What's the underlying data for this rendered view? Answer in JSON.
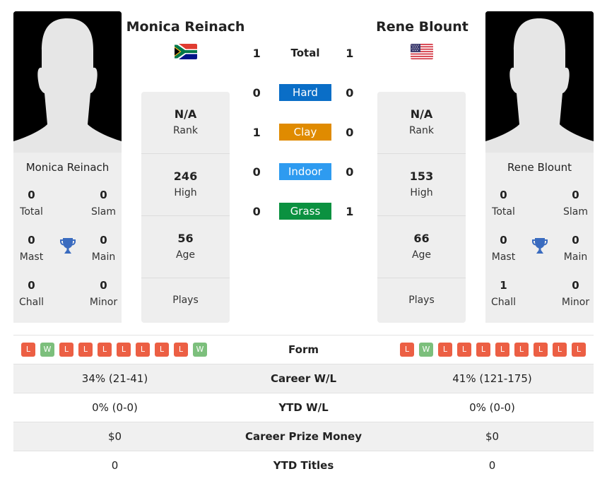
{
  "players": {
    "left": {
      "name": "Monica Reinach",
      "country": "South Africa",
      "flag_icon": "flag-south-africa-icon",
      "titles": {
        "total": {
          "value": "0",
          "label": "Total"
        },
        "slam": {
          "value": "0",
          "label": "Slam"
        },
        "mast": {
          "value": "0",
          "label": "Mast"
        },
        "main": {
          "value": "0",
          "label": "Main"
        },
        "chall": {
          "value": "0",
          "label": "Chall"
        },
        "minor": {
          "value": "0",
          "label": "Minor"
        }
      },
      "stats": {
        "rank": {
          "value": "N/A",
          "label": "Rank"
        },
        "high": {
          "value": "246",
          "label": "High"
        },
        "age": {
          "value": "56",
          "label": "Age"
        },
        "plays": {
          "value": "",
          "label": "Plays"
        }
      },
      "form": [
        "L",
        "W",
        "L",
        "L",
        "L",
        "L",
        "L",
        "L",
        "L",
        "W"
      ]
    },
    "right": {
      "name": "Rene Blount",
      "country": "United States",
      "flag_icon": "flag-usa-icon",
      "titles": {
        "total": {
          "value": "0",
          "label": "Total"
        },
        "slam": {
          "value": "0",
          "label": "Slam"
        },
        "mast": {
          "value": "0",
          "label": "Mast"
        },
        "main": {
          "value": "0",
          "label": "Main"
        },
        "chall": {
          "value": "1",
          "label": "Chall"
        },
        "minor": {
          "value": "0",
          "label": "Minor"
        }
      },
      "stats": {
        "rank": {
          "value": "N/A",
          "label": "Rank"
        },
        "high": {
          "value": "153",
          "label": "High"
        },
        "age": {
          "value": "66",
          "label": "Age"
        },
        "plays": {
          "value": "",
          "label": "Plays"
        }
      },
      "form": [
        "L",
        "W",
        "L",
        "L",
        "L",
        "L",
        "L",
        "L",
        "L",
        "L"
      ]
    }
  },
  "h2h": [
    {
      "label": "Total",
      "left": "1",
      "right": "1",
      "color": ""
    },
    {
      "label": "Hard",
      "left": "0",
      "right": "0",
      "color": "#0a6ec7"
    },
    {
      "label": "Clay",
      "left": "1",
      "right": "0",
      "color": "#e08b00"
    },
    {
      "label": "Indoor",
      "left": "0",
      "right": "0",
      "color": "#2e9bf0"
    },
    {
      "label": "Grass",
      "left": "0",
      "right": "1",
      "color": "#0b9140"
    }
  ],
  "comparison": [
    {
      "label": "Form",
      "left": "",
      "right": ""
    },
    {
      "label": "Career W/L",
      "left": "34% (21-41)",
      "right": "41% (121-175)"
    },
    {
      "label": "YTD W/L",
      "left": "0% (0-0)",
      "right": "0% (0-0)"
    },
    {
      "label": "Career Prize Money",
      "left": "$0",
      "right": "$0"
    },
    {
      "label": "YTD Titles",
      "left": "0",
      "right": "0"
    }
  ],
  "colors": {
    "win": "#7cbf7c",
    "loss": "#ec5f44",
    "trophy": "#3a6bbf",
    "card_bg": "#eeeeee"
  }
}
